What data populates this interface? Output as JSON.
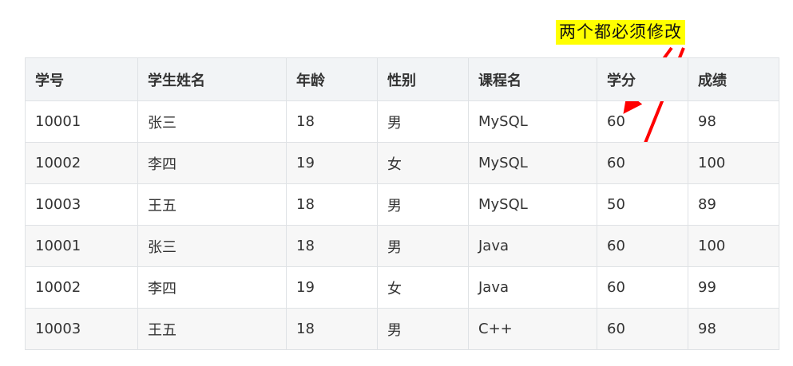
{
  "annotation": {
    "label": "两个都必须修改",
    "color": "#ff0000",
    "highlight": "#ffff00"
  },
  "table": {
    "headers": [
      "学号",
      "学生姓名",
      "年龄",
      "性别",
      "课程名",
      "学分",
      "成绩"
    ],
    "rows": [
      [
        "10001",
        "张三",
        "18",
        "男",
        "MySQL",
        "60",
        "98"
      ],
      [
        "10002",
        "李四",
        "19",
        "女",
        "MySQL",
        "60",
        "100"
      ],
      [
        "10003",
        "王五",
        "18",
        "男",
        "MySQL",
        "50",
        "89"
      ],
      [
        "10001",
        "张三",
        "18",
        "男",
        "Java",
        "60",
        "100"
      ],
      [
        "10002",
        "李四",
        "19",
        "女",
        "Java",
        "60",
        "99"
      ],
      [
        "10003",
        "王五",
        "18",
        "男",
        "C++",
        "60",
        "98"
      ]
    ]
  }
}
